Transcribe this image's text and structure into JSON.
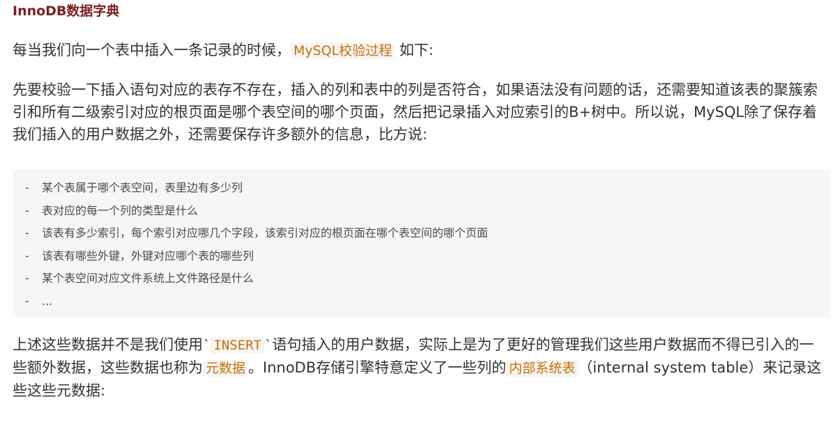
{
  "heading": "InnoDB数据字典",
  "p1": {
    "before": "每当我们向一个表中插入一条记录的时候，",
    "code": "MySQL校验过程",
    "after": "如下:"
  },
  "p2": {
    "text": "先要校验一下插入语句对应的表存不存在，插入的列和表中的列是否符合，如果语法没有问题的话，还需要知道该表的聚簇索引和所有二级索引对应的根页面是哪个表空间的哪个页面，然后把记录插入对应索引的B+树中。所以说，MySQL除了保存着我们插入的用户数据之外，还需要保存许多额外的信息，比方说:"
  },
  "list": {
    "dash": "-",
    "items": [
      "某个表属于哪个表空间，表里边有多少列",
      "表对应的每一个列的类型是什么",
      "该表有多少索引，每个索引对应哪几个字段，该索引对应的根页面在哪个表空间的哪个页面",
      "该表有哪些外键，外键对应哪个表的哪些列",
      "某个表空间对应文件系统上文件路径是什么",
      "..."
    ]
  },
  "p3": {
    "t1": "上述这些数据并不是我们使用",
    "tick": "`",
    "code1": "INSERT",
    "t2": "语句插入的用户数据，实际上是为了更好的管理我们这些用户数据而不得已引入的一些额外数据，这些数据也称为",
    "code2": "元数据",
    "t3": "。InnoDB存储引擎特意定义了一些列的",
    "code3": "内部系统表",
    "t4": "（internal system table）来记录这些这些元数据:"
  }
}
